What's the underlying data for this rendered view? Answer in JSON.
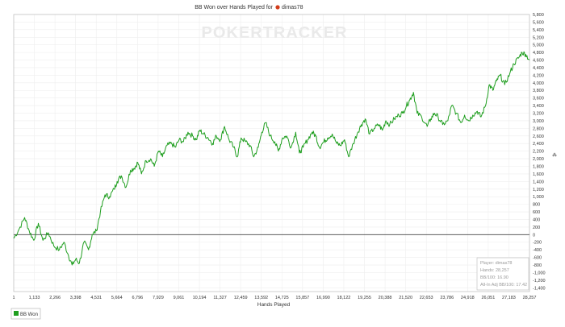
{
  "title_prefix": "BB Won over Hands Played for",
  "player_name": "dimas78",
  "watermark": "POKERTRACKER",
  "colors": {
    "series": "#1f9e1f",
    "grid": "#eeeeee",
    "zero_line": "#444444",
    "plot_border": "#bbbbbb",
    "flag_icon": "#d23c1a"
  },
  "stats_box": {
    "player": "Player: dimas78",
    "hands": "Hands: 28,257",
    "bb100": "BB/100: 16.90",
    "allin": "All-In Adj BB/100: 17.42"
  },
  "chart_data": {
    "type": "line",
    "title": "BB Won over Hands Played for dimas78",
    "xlabel": "Hands Played",
    "ylabel": "",
    "xlim": [
      1,
      28257
    ],
    "ylim": [
      -1500,
      5800
    ],
    "y_ticks": [
      -1400,
      -1200,
      -1000,
      -800,
      -600,
      -400,
      -200,
      0,
      200,
      400,
      600,
      800,
      1000,
      1200,
      1400,
      1600,
      1800,
      2000,
      2200,
      2400,
      2600,
      2800,
      3000,
      3200,
      3400,
      3600,
      3800,
      4000,
      4200,
      4400,
      4600,
      4800,
      5000,
      5200,
      5400,
      5600,
      5800
    ],
    "x_tick_labels": [
      "1",
      "1,133",
      "2,266",
      "3,398",
      "4,531",
      "5,664",
      "6,796",
      "7,929",
      "9,061",
      "10,194",
      "11,327",
      "12,459",
      "13,592",
      "14,725",
      "15,857",
      "16,990",
      "18,122",
      "19,255",
      "20,388",
      "21,520",
      "22,653",
      "23,786",
      "24,918",
      "26,051",
      "27,183",
      "28,257"
    ],
    "legend": [
      "BB Won"
    ],
    "series": [
      {
        "name": "BB Won",
        "x": [
          1,
          300,
          600,
          850,
          1100,
          1350,
          1600,
          1900,
          2200,
          2500,
          2750,
          3000,
          3200,
          3398,
          3600,
          3850,
          4100,
          4300,
          4531,
          4750,
          5000,
          5250,
          5500,
          5664,
          5900,
          6150,
          6400,
          6600,
          6796,
          7000,
          7250,
          7500,
          7700,
          7929,
          8150,
          8400,
          8650,
          8850,
          9061,
          9300,
          9550,
          9800,
          10000,
          10194,
          10400,
          10650,
          10900,
          11100,
          11327,
          11550,
          11800,
          12050,
          12250,
          12459,
          12700,
          12950,
          13150,
          13400,
          13592,
          13800,
          14050,
          14300,
          14500,
          14725,
          14950,
          15200,
          15450,
          15650,
          15857,
          16100,
          16350,
          16550,
          16750,
          16990,
          17200,
          17450,
          17700,
          17900,
          18122,
          18350,
          18600,
          18850,
          19050,
          19255,
          19500,
          19750,
          20000,
          20200,
          20388,
          20600,
          20850,
          21100,
          21300,
          21520,
          21700,
          21900,
          22100,
          22350,
          22653,
          22850,
          23050,
          23250,
          23500,
          23786,
          24000,
          24250,
          24500,
          24700,
          24918,
          25150,
          25400,
          25600,
          25850,
          26051,
          26250,
          26450,
          26650,
          26900,
          27183,
          27400,
          27650,
          27850,
          28050,
          28257
        ],
        "values": [
          -100,
          150,
          450,
          100,
          -150,
          300,
          -150,
          50,
          -300,
          -400,
          -200,
          -550,
          -800,
          -650,
          -750,
          -200,
          -400,
          0,
          100,
          600,
          1050,
          1000,
          1200,
          1400,
          1550,
          1250,
          1700,
          1750,
          1900,
          1600,
          1950,
          2000,
          1800,
          2200,
          2050,
          2350,
          2400,
          2300,
          2500,
          2450,
          2700,
          2600,
          2500,
          2750,
          2650,
          2550,
          2400,
          2600,
          2500,
          2850,
          2500,
          2300,
          2050,
          2550,
          2450,
          2350,
          2050,
          2300,
          2700,
          2950,
          2600,
          2450,
          2200,
          2550,
          2600,
          2300,
          2700,
          2150,
          2300,
          2500,
          2700,
          2600,
          2300,
          2450,
          2550,
          2650,
          2400,
          2350,
          2500,
          2050,
          2400,
          2700,
          2900,
          3050,
          2650,
          2800,
          2900,
          2750,
          3000,
          2900,
          3050,
          3150,
          3200,
          3400,
          3550,
          3750,
          3200,
          3100,
          2850,
          3050,
          3200,
          3100,
          2900,
          3000,
          3400,
          3200,
          2950,
          3150,
          3000,
          3150,
          3250,
          3100,
          3400,
          3950,
          3800,
          4050,
          4200,
          3950,
          4250,
          4500,
          4650,
          4800,
          4750,
          4600
        ]
      }
    ]
  }
}
